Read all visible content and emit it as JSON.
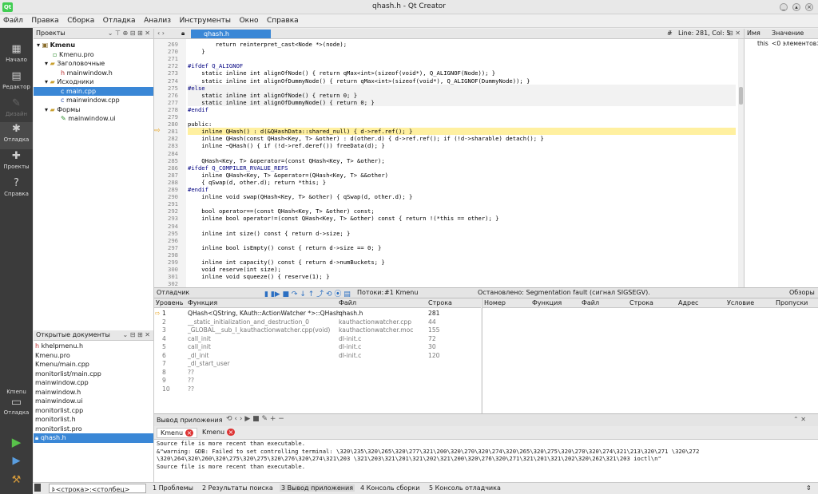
{
  "window": {
    "title": "qhash.h - Qt Creator",
    "app_icon": "Qt"
  },
  "menu": [
    "Файл",
    "Правка",
    "Сборка",
    "Отладка",
    "Анализ",
    "Инструменты",
    "Окно",
    "Справка"
  ],
  "modes": [
    "Начало",
    "Редактор",
    "Дизайн",
    "Отладка",
    "Проекты",
    "Справка"
  ],
  "kit": {
    "name": "Kmenu",
    "mode": "Отладка"
  },
  "projects": {
    "title": "Проекты",
    "items": [
      "Kmenu",
      "Kmenu.pro",
      "Заголовочные",
      "mainwindow.h",
      "Исходники",
      "main.cpp",
      "mainwindow.cpp",
      "Формы",
      "mainwindow.ui"
    ]
  },
  "open_docs": {
    "title": "Открытые документы",
    "items": [
      "khelpmenu.h",
      "Kmenu.pro",
      "Kmenu/main.cpp",
      "monitorlist/main.cpp",
      "mainwindow.cpp",
      "mainwindow.h",
      "mainwindow.ui",
      "monitorlist.cpp",
      "monitorlist.h",
      "monitorlist.pro",
      "qhash.h"
    ]
  },
  "editor": {
    "file": "qhash.h",
    "hash": "#",
    "position": "Line: 281, Col: 5",
    "lines": [
      {
        "n": "269",
        "t": "        return reinterpret_cast<Node *>(node);"
      },
      {
        "n": "270",
        "t": "    }"
      },
      {
        "n": "271",
        "t": ""
      },
      {
        "n": "272",
        "t": "#ifdef Q_ALIGNOF"
      },
      {
        "n": "273",
        "t": "    static inline int alignOfNode() { return qMax<int>(sizeof(void*), Q_ALIGNOF(Node)); }"
      },
      {
        "n": "274",
        "t": "    static inline int alignOfDummyNode() { return qMax<int>(sizeof(void*), Q_ALIGNOF(DummyNode)); }"
      },
      {
        "n": "275",
        "t": "#else"
      },
      {
        "n": "276",
        "t": "    static inline int alignOfNode() { return 0; }"
      },
      {
        "n": "277",
        "t": "    static inline int alignOfDummyNode() { return 0; }"
      },
      {
        "n": "278",
        "t": "#endif"
      },
      {
        "n": "279",
        "t": ""
      },
      {
        "n": "280",
        "t": "public:"
      },
      {
        "n": "281",
        "t": "    inline QHash() : d(&QHashData::shared_null) { d->ref.ref(); }"
      },
      {
        "n": "282",
        "t": "    inline QHash(const QHash<Key, T> &other) : d(other.d) { d->ref.ref(); if (!d->sharable) detach(); }"
      },
      {
        "n": "283",
        "t": "    inline ~QHash() { if (!d->ref.deref()) freeData(d); }"
      },
      {
        "n": "284",
        "t": ""
      },
      {
        "n": "285",
        "t": "    QHash<Key, T> &operator=(const QHash<Key, T> &other);"
      },
      {
        "n": "286",
        "t": "#ifdef Q_COMPILER_RVALUE_REFS"
      },
      {
        "n": "287",
        "t": "    inline QHash<Key, T> &operator=(QHash<Key, T> &&other)"
      },
      {
        "n": "288",
        "t": "    { qSwap(d, other.d); return *this; }"
      },
      {
        "n": "289",
        "t": "#endif"
      },
      {
        "n": "290",
        "t": "    inline void swap(QHash<Key, T> &other) { qSwap(d, other.d); }"
      },
      {
        "n": "291",
        "t": ""
      },
      {
        "n": "292",
        "t": "    bool operator==(const QHash<Key, T> &other) const;"
      },
      {
        "n": "293",
        "t": "    inline bool operator!=(const QHash<Key, T> &other) const { return !(*this == other); }"
      },
      {
        "n": "294",
        "t": ""
      },
      {
        "n": "295",
        "t": "    inline int size() const { return d->size; }"
      },
      {
        "n": "296",
        "t": ""
      },
      {
        "n": "297",
        "t": "    inline bool isEmpty() const { return d->size == 0; }"
      },
      {
        "n": "298",
        "t": ""
      },
      {
        "n": "299",
        "t": "    inline int capacity() const { return d->numBuckets; }"
      },
      {
        "n": "300",
        "t": "    void reserve(int size);"
      },
      {
        "n": "301",
        "t": "    inline void squeeze() { reserve(1); }"
      },
      {
        "n": "302",
        "t": ""
      }
    ]
  },
  "locals": {
    "col_name": "Имя",
    "col_value": "Значение",
    "rows": [
      {
        "name": "this",
        "value": "<0 элементов>"
      }
    ]
  },
  "debugger": {
    "title": "Отладчик",
    "threads_label": "Потоки:",
    "thread": "#1 Kmenu",
    "status": "Остановлено: Segmentation fault (сигнал SIGSEGV).",
    "views": "Обзоры"
  },
  "stack": {
    "headers": [
      "Уровень",
      "Функция",
      "Файл",
      "Строка"
    ],
    "rows": [
      {
        "level": "1",
        "func": "QHash<QString, KAuth::ActionWatcher *>::QHash",
        "file": "qhash.h",
        "line": "281"
      },
      {
        "level": "2",
        "func": "__static_initialization_and_destruction_0",
        "file": "kauthactionwatcher.cpp",
        "line": "44"
      },
      {
        "level": "3",
        "func": "_GLOBAL__sub_I_kauthactionwatcher.cpp(void)",
        "file": "kauthactionwatcher.moc",
        "line": "155"
      },
      {
        "level": "4",
        "func": "call_init",
        "file": "dl-init.c",
        "line": "72"
      },
      {
        "level": "5",
        "func": "call_init",
        "file": "dl-init.c",
        "line": "30"
      },
      {
        "level": "6",
        "func": "_dl_init",
        "file": "dl-init.c",
        "line": "120"
      },
      {
        "level": "7",
        "func": "_dl_start_user",
        "file": "",
        "line": ""
      },
      {
        "level": "8",
        "func": "??",
        "file": "",
        "line": ""
      },
      {
        "level": "9",
        "func": "??",
        "file": "",
        "line": ""
      },
      {
        "level": "10",
        "func": "??",
        "file": "",
        "line": ""
      }
    ]
  },
  "breakpoints": {
    "headers": [
      "Номер",
      "Функция",
      "Файл",
      "Строка",
      "Адрес",
      "Условие",
      "Пропуски"
    ]
  },
  "output": {
    "title": "Вывод приложения",
    "tabs": [
      "Kmenu",
      "Kmenu"
    ],
    "lines": [
      "Source file is more recent than executable.",
      "&\"warning: GDB: Failed to set controlling terminal: \\320\\235\\320\\265\\320\\277\\321\\200\\320\\270\\320\\274\\320\\265\\320\\275\\320\\270\\320\\274\\321\\213\\320\\271 \\320\\272",
      "\\320\\264\\320\\260\\320\\275\\320\\275\\320\\276\\320\\274\\321\\203 \\321\\203\\321\\201\\321\\202\\321\\200\\320\\276\\320\\271\\321\\201\\321\\202\\320\\262\\321\\203 ioctl\\n\"",
      "Source file is more recent than executable."
    ]
  },
  "status": {
    "locator_placeholder": "l <строка>:<столбец>",
    "panes": [
      "1 Проблемы",
      "2 Результаты поиска",
      "3 Вывод приложения",
      "4 Консоль сборки",
      "5 Консоль отладчика"
    ]
  }
}
